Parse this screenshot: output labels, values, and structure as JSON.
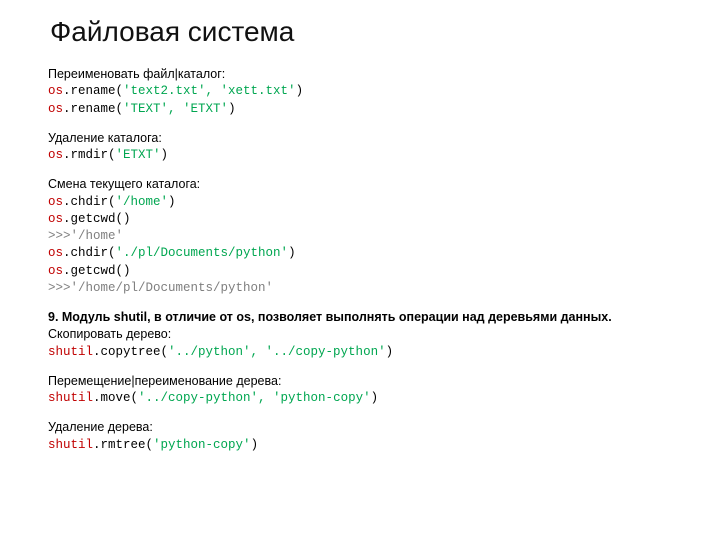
{
  "title": "Файловая система",
  "sec1": {
    "heading": "Переименовать файл|каталог:",
    "line1_mod": "os",
    "line1_call": ".rename(",
    "line1_arg": "'text2.txt', 'xett.txt'",
    "line1_close": ")",
    "line2_mod": "os",
    "line2_call": ".rename(",
    "line2_arg": "'TEXT', 'ETXT'",
    "line2_close": ")"
  },
  "sec2": {
    "heading": "Удаление каталога:",
    "line1_mod": "os",
    "line1_call": ".rmdir(",
    "line1_arg": "'ETXT'",
    "line1_close": ")"
  },
  "sec3": {
    "heading": "Смена текущего каталога:",
    "l1_mod": "os",
    "l1_call": ".chdir(",
    "l1_arg": "'/home'",
    "l1_close": ")",
    "l2_mod": "os",
    "l2_call": ".getcwd()",
    "l3_out": ">>>'/home'",
    "l4_mod": "os",
    "l4_call": ".chdir(",
    "l4_arg": "'./pl/Documents/python'",
    "l4_close": ")",
    "l5_mod": "os",
    "l5_call": ".getcwd()",
    "l6_out": ">>>'/home/pl/Documents/python'"
  },
  "sec4": {
    "bold": "9. Модуль shutil, в отличие от os, позволяет выполнять операции над деревьями данных.",
    "heading": "Скопировать дерево:",
    "l1_mod": "shutil",
    "l1_call": ".copytree(",
    "l1_arg": "'../python', '../copy-python'",
    "l1_close": ")"
  },
  "sec5": {
    "heading": "Перемещение|переименование дерева:",
    "l1_mod": "shutil",
    "l1_call": ".move(",
    "l1_arg": "'../copy-python', 'python-copy'",
    "l1_close": ")"
  },
  "sec6": {
    "heading": "Удаление дерева:",
    "l1_mod": "shutil",
    "l1_call": ".rmtree(",
    "l1_arg": "'python-copy'",
    "l1_close": ")"
  }
}
